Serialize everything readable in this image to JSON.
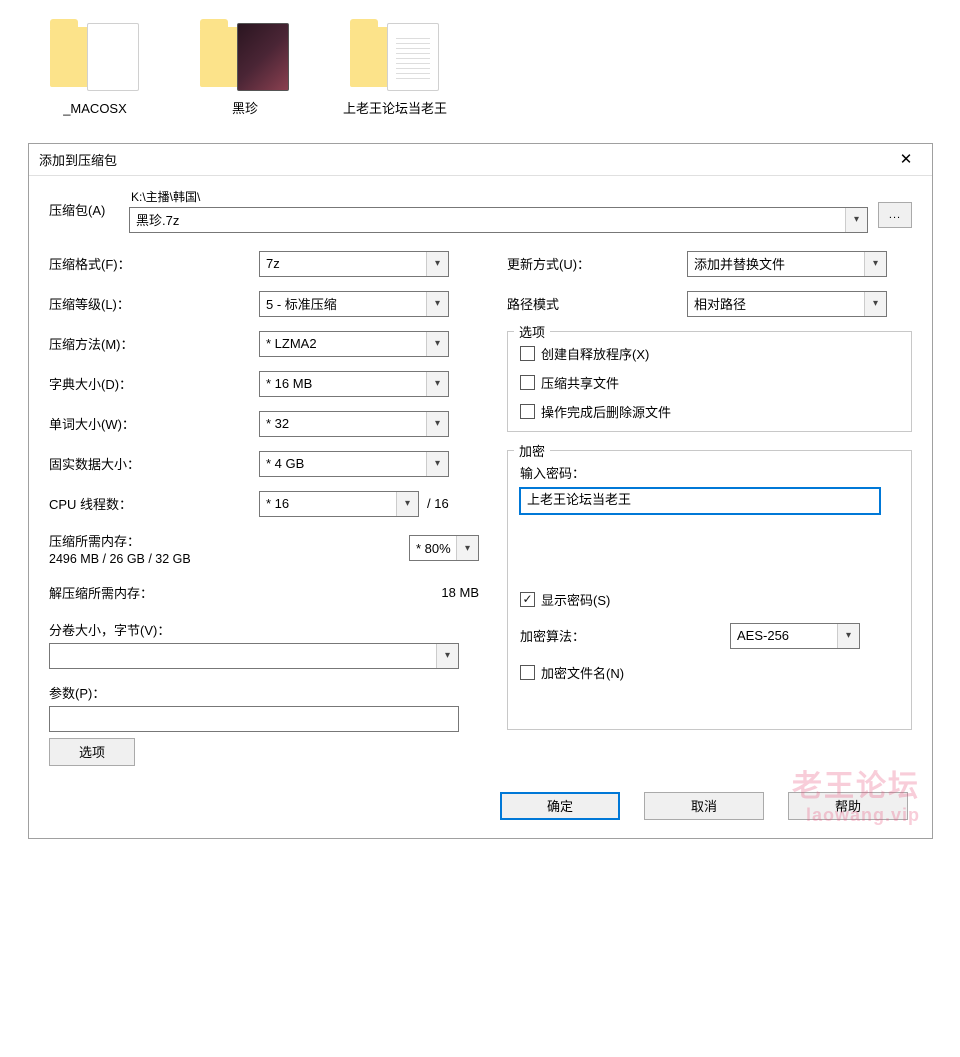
{
  "folders": [
    {
      "name": "_MACOSX"
    },
    {
      "name": "黑珍"
    },
    {
      "name": "上老王论坛当老王"
    }
  ],
  "dialog": {
    "title": "添加到压缩包",
    "archive_label": "压缩包(A)",
    "archive_path": "K:\\主播\\韩国\\",
    "archive_file": "黑珍.7z",
    "left": {
      "format_label": "压缩格式(F)：",
      "format_value": "7z",
      "level_label": "压缩等级(L)：",
      "level_value": "5 - 标准压缩",
      "method_label": "压缩方法(M)：",
      "method_value": "* LZMA2",
      "dict_label": "字典大小(D)：",
      "dict_value": "* 16 MB",
      "word_label": "单词大小(W)：",
      "word_value": "* 32",
      "solid_label": "固实数据大小：",
      "solid_value": "* 4 GB",
      "threads_label": "CPU 线程数：",
      "threads_value": "* 16",
      "threads_suffix": "/ 16",
      "mem_c_label": "压缩所需内存：",
      "mem_c_value": "2496 MB / 26 GB / 32 GB",
      "mem_c_pct": "* 80%",
      "mem_d_label": "解压缩所需内存：",
      "mem_d_value": "18 MB",
      "split_label": "分卷大小，字节(V)：",
      "params_label": "参数(P)：",
      "options_btn": "选项"
    },
    "right": {
      "update_label": "更新方式(U)：",
      "update_value": "添加并替换文件",
      "path_label": "路径模式",
      "path_value": "相对路径",
      "options_legend": "选项",
      "opt_sfx": "创建自释放程序(X)",
      "opt_share": "压缩共享文件",
      "opt_delete": "操作完成后删除源文件",
      "encrypt_legend": "加密",
      "pw_label": "输入密码：",
      "pw_value": "上老王论坛当老王",
      "show_pw": "显示密码(S)",
      "enc_alg_label": "加密算法：",
      "enc_alg_value": "AES-256",
      "enc_names": "加密文件名(N)"
    },
    "footer": {
      "ok": "确定",
      "cancel": "取消",
      "help": "帮助"
    }
  },
  "watermark": {
    "line1": "老王论坛",
    "line2": "laowang.vip"
  }
}
